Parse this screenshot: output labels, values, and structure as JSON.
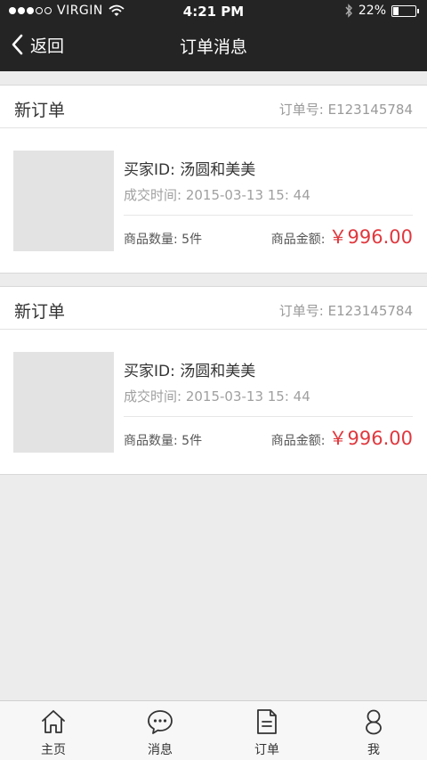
{
  "status_bar": {
    "carrier": "VIRGIN",
    "time": "4:21 PM",
    "battery": "22%"
  },
  "nav": {
    "back_label": "返回",
    "title": "订单消息"
  },
  "orders": [
    {
      "title": "新订单",
      "order_no": "订单号: E123145784",
      "buyer": "买家ID: 汤圆和美美",
      "time": "成交时间: 2015-03-13 15: 44",
      "quantity": "商品数量: 5件",
      "amount_label": "商品金额:",
      "amount_value": "￥996.00"
    },
    {
      "title": "新订单",
      "order_no": "订单号: E123145784",
      "buyer": "买家ID: 汤圆和美美",
      "time": "成交时间: 2015-03-13 15: 44",
      "quantity": "商品数量: 5件",
      "amount_label": "商品金额:",
      "amount_value": "￥996.00"
    }
  ],
  "tabbar": {
    "items": [
      {
        "label": "主页",
        "icon": "home-icon"
      },
      {
        "label": "消息",
        "icon": "message-icon"
      },
      {
        "label": "订单",
        "icon": "order-icon"
      },
      {
        "label": "我",
        "icon": "user-icon"
      }
    ]
  },
  "colors": {
    "header_bg": "#242424",
    "price": "#e0383e",
    "page_bg": "#ececec"
  }
}
